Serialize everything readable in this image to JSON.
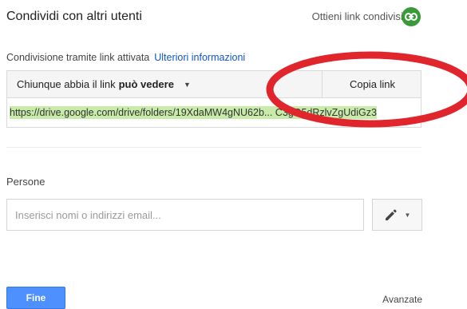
{
  "dialog": {
    "title": "Condividi con altri utenti",
    "get_link_label": "Ottieni link condivisibile"
  },
  "link_sharing": {
    "status_text": "Condivisione tramite link attivata",
    "more_info": "Ulteriori informazioni",
    "permission_prefix": "Chiunque abbia il link",
    "permission_level": "può vedere",
    "copy_button": "Copia link",
    "url": "https://drive.google.com/drive/folders/19XdaMW4gNU62b... C3gO5dRzlvZgUdiGz3"
  },
  "people": {
    "label": "Persone",
    "input_placeholder": "Inserisci nomi o indirizzi email..."
  },
  "footer": {
    "done_button": "Fine",
    "advanced_link": "Avanzate"
  },
  "colors": {
    "accent_blue": "#4d90fe",
    "link_blue": "#1155cc",
    "badge_green": "#3a9a39",
    "url_highlight": "#c8ebaa",
    "annotation_red": "#e0252c"
  },
  "icons": {
    "link_badge": "link-icon",
    "permission_caret": "chevron-down-icon",
    "edit": "pencil-icon"
  }
}
